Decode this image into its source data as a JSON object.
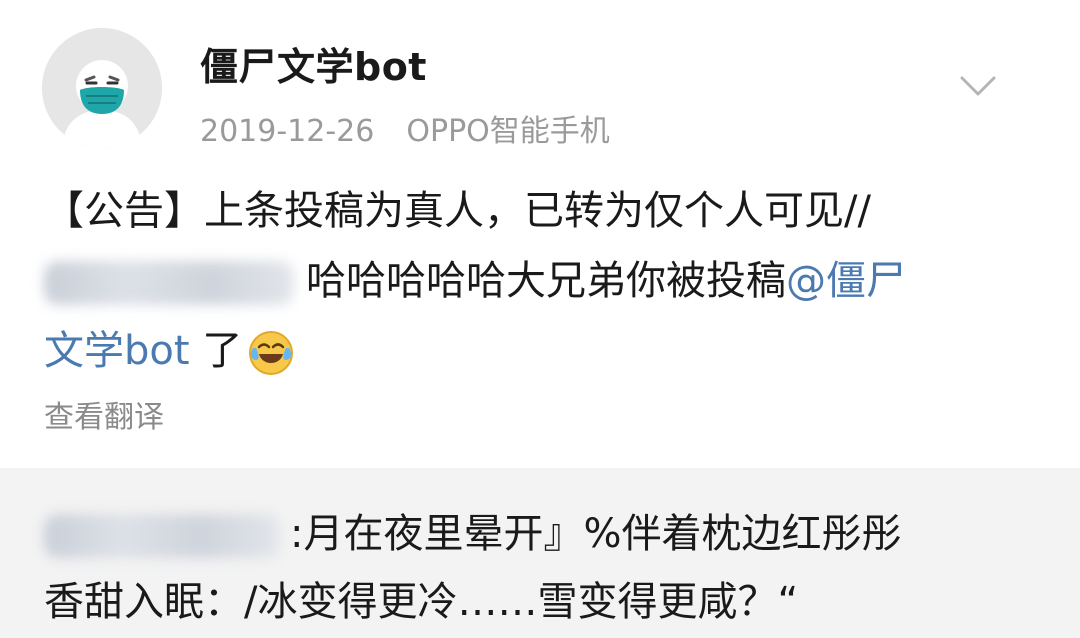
{
  "post": {
    "author": "僵尸文学bot",
    "date": "2019-12-26",
    "source": "OPPO智能手机",
    "icons": {
      "avatar": "masked-face-avatar",
      "menu": "chevron-down-icon",
      "emoji": "laughing-crying-emoji-icon"
    },
    "text": {
      "line1": "【公告】上条投稿为真人，已转为仅个人可见//",
      "line2_text": "哈哈哈哈哈大兄弟你被投稿",
      "line2_link": "@僵尸",
      "line3_link": "文学bot",
      "line3_text": " 了"
    },
    "translate_label": "查看翻译"
  },
  "repost": {
    "line1": ":月在夜里晕开』%伴着枕边红彤彤",
    "line2": "香甜入眠：/冰变得更冷……雪变得更咸？“"
  },
  "colors": {
    "link": "#4a7ab0",
    "meta": "#9a9a9a",
    "repost_bg": "#f3f3f3",
    "mask": "#1ea6a8"
  }
}
